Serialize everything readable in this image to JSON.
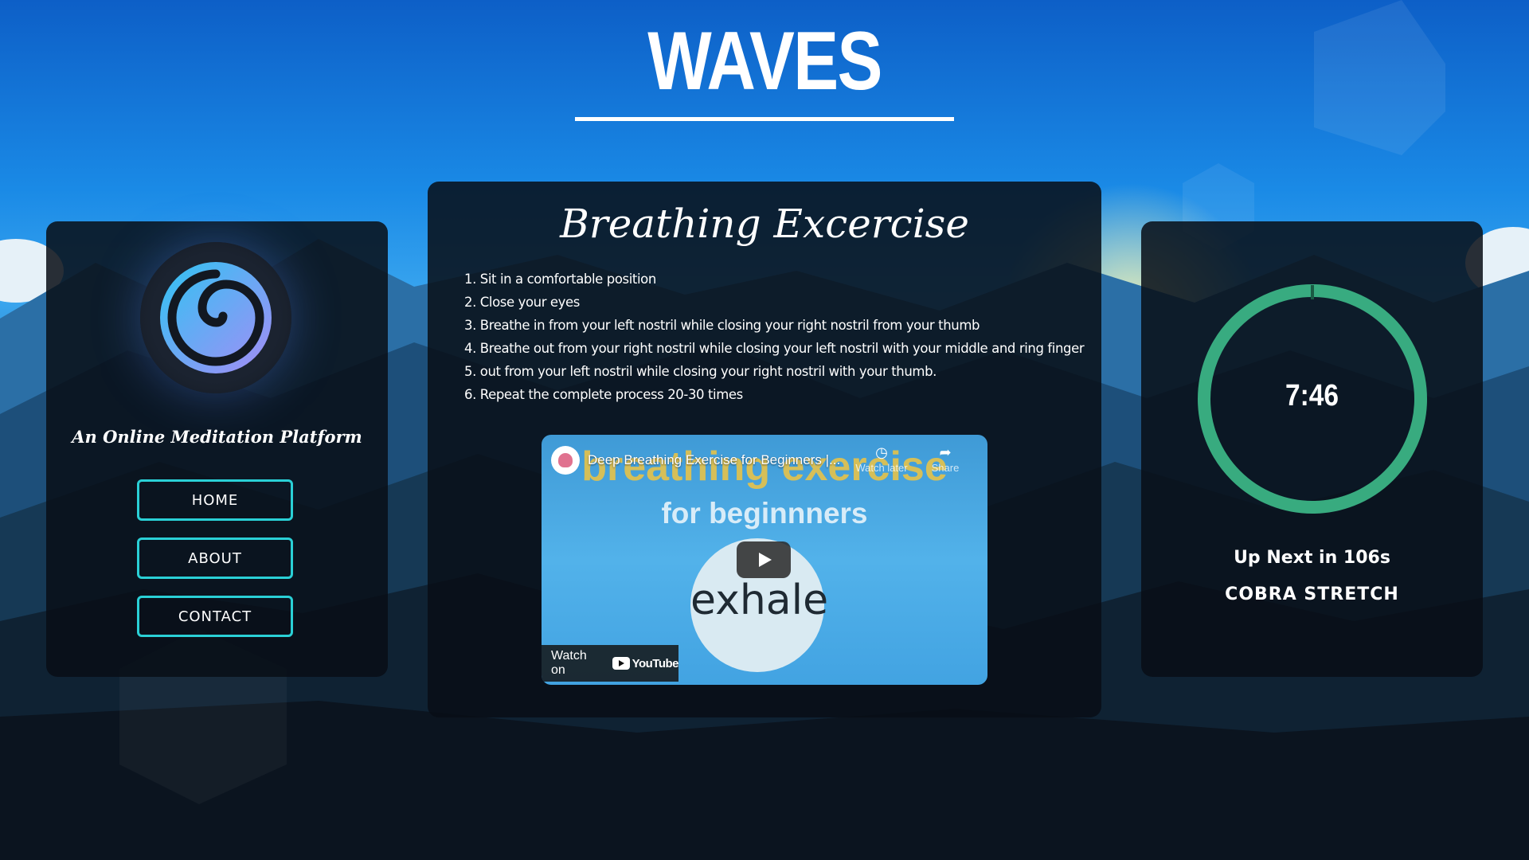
{
  "app": {
    "title": "WAVES",
    "tagline": "An Online Meditation Platform"
  },
  "nav": {
    "items": [
      {
        "label": "HOME"
      },
      {
        "label": "ABOUT"
      },
      {
        "label": "CONTACT"
      }
    ],
    "accent_color": "#2ad0d6"
  },
  "exercise": {
    "title": "Breathing Excercise",
    "steps": [
      "1. Sit in a comfortable position",
      "2. Close your eyes",
      "3. Breathe in from your left nostril while closing your right nostril from your thumb",
      "4. Breathe out from your right nostril while closing your left nostril with your middle and ring finger",
      "5. out from your left nostril while closing your right nostril with your thumb.",
      "6. Repeat the complete process 20-30 times"
    ]
  },
  "video": {
    "title": "Deep Breathing Exercise for Beginners |...",
    "watch_later": "Watch later",
    "share": "Share",
    "thumb_line1": "breathing exercise",
    "thumb_line2": "for beginnners",
    "thumb_word": "exhale",
    "watch_on": "Watch on",
    "platform": "YouTube"
  },
  "timer": {
    "value": "7:46",
    "up_next": "Up Next in 106s",
    "next_exercise": "COBRA STRETCH",
    "ring_color": "#3dbb8a"
  }
}
